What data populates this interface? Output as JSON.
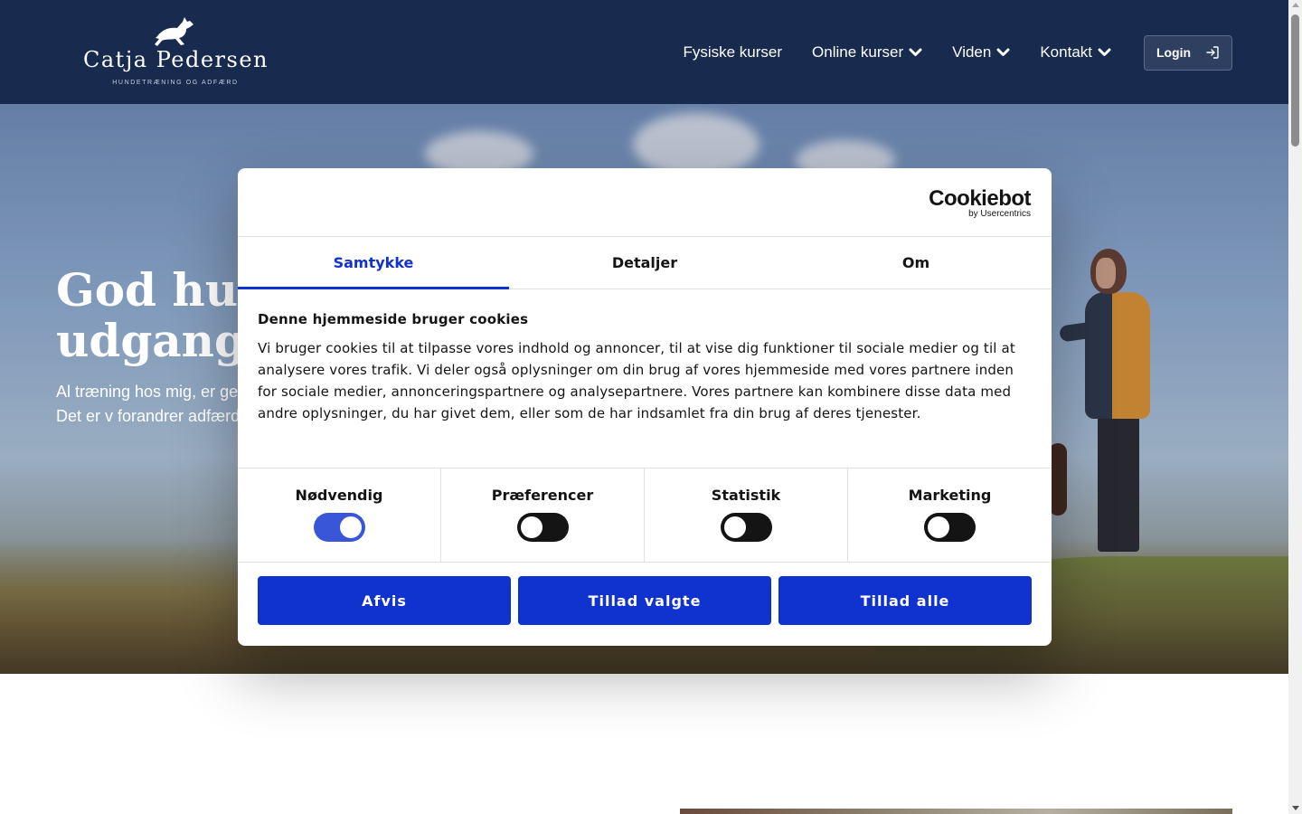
{
  "header": {
    "logo_name": "Catja Pedersen",
    "logo_tagline": "HUNDETRÆNING OG ADFÆRD",
    "nav": [
      {
        "label": "Fysiske kurser",
        "dropdown": false
      },
      {
        "label": "Online kurser",
        "dropdown": true
      },
      {
        "label": "Viden",
        "dropdown": true
      },
      {
        "label": "Kontakt",
        "dropdown": true
      }
    ],
    "login_label": "Login"
  },
  "hero": {
    "title_line1": "God hun",
    "title_line2": "udgangsp",
    "text": "Al træning hos mig, er ge år i efteruddannelse og i lærer en masse. Det er v forandrer adfærd, så du s gjort” er ikke et holdbart"
  },
  "cookie_dialog": {
    "brand": "Cookiebot",
    "brand_sub": "by Usercentrics",
    "tabs": [
      {
        "label": "Samtykke",
        "active": true
      },
      {
        "label": "Detaljer",
        "active": false
      },
      {
        "label": "Om",
        "active": false
      }
    ],
    "heading": "Denne hjemmeside bruger cookies",
    "body": "Vi bruger cookies til at tilpasse vores indhold og annoncer, til at vise dig funktioner til sociale medier og til at analysere vores trafik. Vi deler også oplysninger om din brug af vores hjemmeside med vores partnere inden for sociale medier, annonceringspartnere og analysepartnere. Vores partnere kan kombinere disse data med andre oplysninger, du har givet dem, eller som de har indsamlet fra din brug af deres tjenester.",
    "toggles": [
      {
        "label": "Nødvendig",
        "checked": true
      },
      {
        "label": "Præferencer",
        "checked": false
      },
      {
        "label": "Statistik",
        "checked": false
      },
      {
        "label": "Marketing",
        "checked": false
      }
    ],
    "buttons": {
      "reject": "Afvis",
      "allow_selected": "Tillad valgte",
      "allow_all": "Tillad alle"
    }
  },
  "colors": {
    "header_bg": "#182a4e",
    "accent_blue": "#1032cf",
    "text_dark": "#141414"
  }
}
